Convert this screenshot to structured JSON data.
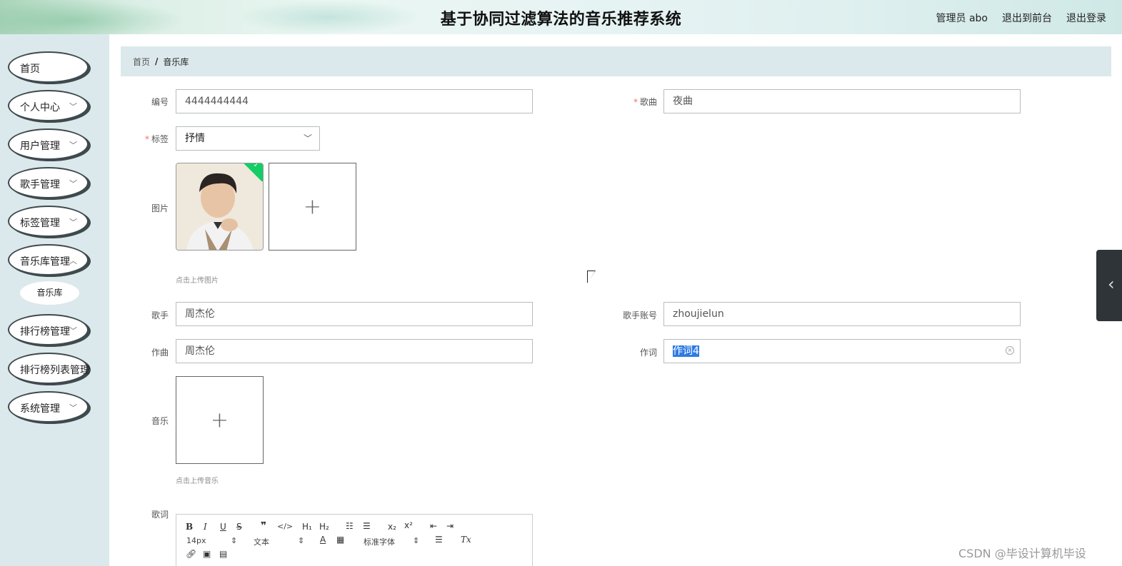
{
  "header": {
    "title": "基于协同过滤算法的音乐推荐系统",
    "admin": "管理员 abo",
    "to_front": "退出到前台",
    "logout": "退出登录"
  },
  "sidebar": {
    "items": [
      {
        "label": "首页",
        "has_chevron": false
      },
      {
        "label": "个人中心",
        "has_chevron": true
      },
      {
        "label": "用户管理",
        "has_chevron": true
      },
      {
        "label": "歌手管理",
        "has_chevron": true
      },
      {
        "label": "标签管理",
        "has_chevron": true
      },
      {
        "label": "音乐库管理",
        "has_chevron": true
      },
      {
        "label": "排行榜管理",
        "has_chevron": true
      },
      {
        "label": "排行榜列表管理",
        "has_chevron": false
      },
      {
        "label": "系统管理",
        "has_chevron": true
      }
    ],
    "submenu_label": "音乐库"
  },
  "breadcrumb": {
    "home": "首页",
    "separator": "/",
    "current": "音乐库"
  },
  "form": {
    "number_label": "编号",
    "number_value": "4444444444",
    "song_label": "歌曲",
    "song_value": "夜曲",
    "tag_label": "标签",
    "tag_value": "抒情",
    "image_label": "图片",
    "image_hint": "点击上传图片",
    "singer_label": "歌手",
    "singer_value": "周杰伦",
    "singer_account_label": "歌手账号",
    "singer_account_value": "zhoujielun",
    "composer_label": "作曲",
    "composer_value": "周杰伦",
    "lyricist_label": "作词",
    "lyricist_value": "作词4",
    "music_label": "音乐",
    "music_hint": "点击上传音乐",
    "lyrics_label": "歌词",
    "required_mark": "*"
  },
  "editor": {
    "font_size": "14px",
    "text_type": "文本",
    "font_family": "标准字体"
  },
  "watermark": "CSDN @毕设计算机毕设",
  "colors": {
    "sidebar_bg": "#dce9ec",
    "selection": "#2f7ae5",
    "success_check": "#13ce66",
    "required": "#f56c6c"
  }
}
